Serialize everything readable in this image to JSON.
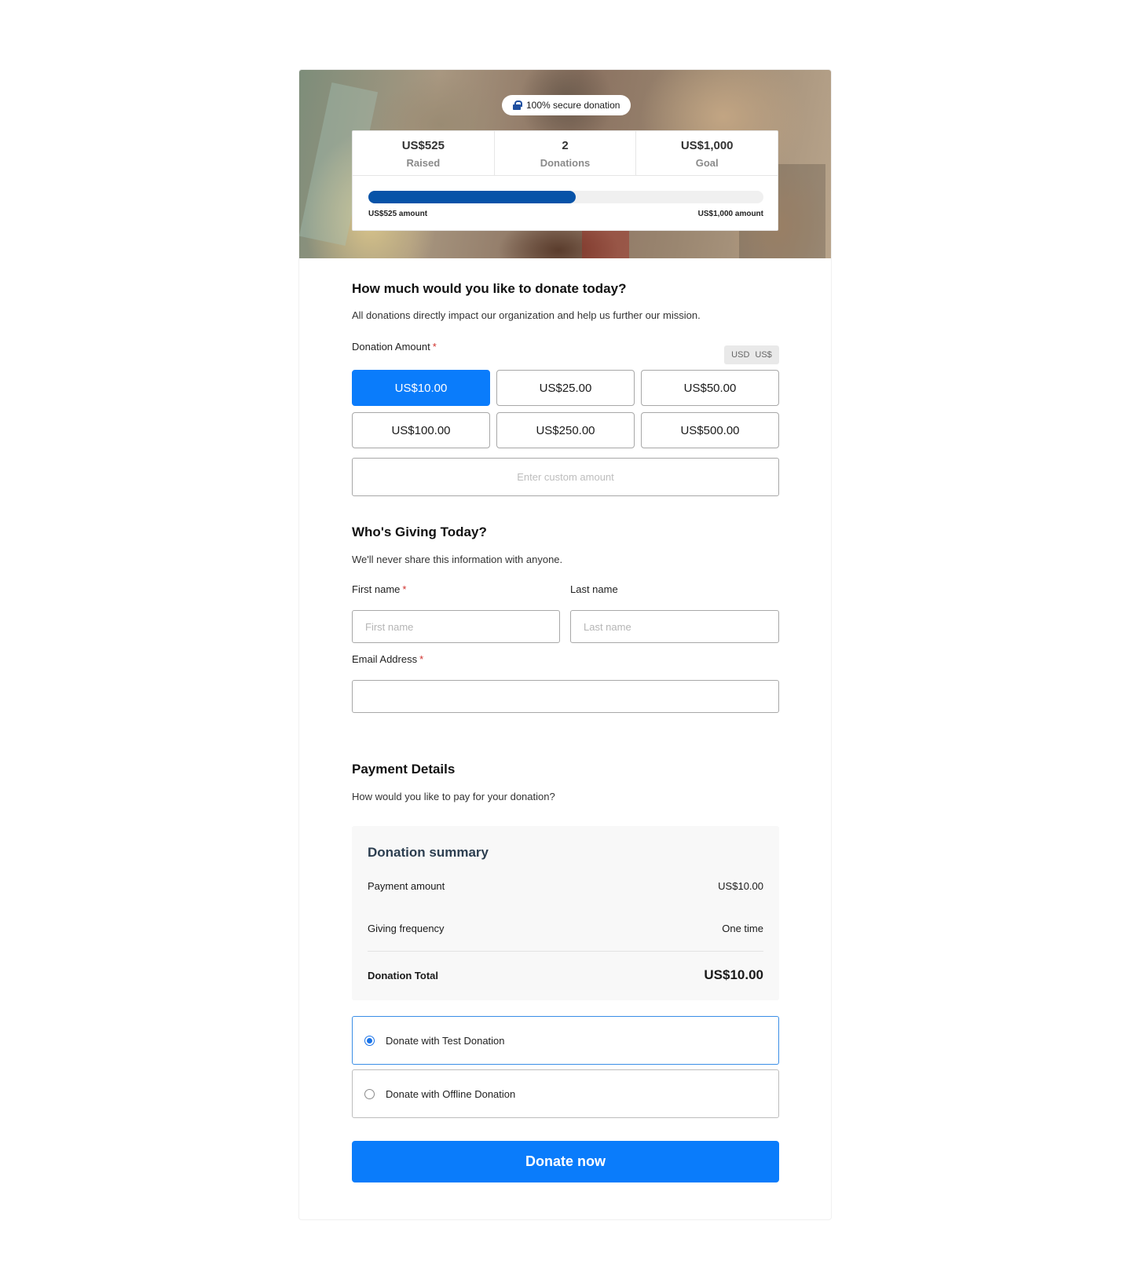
{
  "hero": {
    "secure_badge": "100% secure donation",
    "stats": [
      {
        "value": "US$525",
        "label": "Raised"
      },
      {
        "value": "2",
        "label": "Donations"
      },
      {
        "value": "US$1,000",
        "label": "Goal"
      }
    ],
    "progress_fraction": 0.525,
    "progress_left_label": "US$525 amount",
    "progress_right_label": "US$1,000 amount"
  },
  "amount_section": {
    "title": "How much would you like to donate today?",
    "subtitle": "All donations directly impact our organization and help us further our mission.",
    "field_label": "Donation Amount",
    "required_mark": "*",
    "currency_code": "USD",
    "currency_symbol": "US$",
    "amounts": [
      "US$10.00",
      "US$25.00",
      "US$50.00",
      "US$100.00",
      "US$250.00",
      "US$500.00"
    ],
    "selected_amount": "US$10.00",
    "custom_placeholder": "Enter custom amount"
  },
  "donor_section": {
    "title": "Who's Giving Today?",
    "subtitle": "We'll never share this information with anyone.",
    "first_name_label": "First name",
    "first_name_placeholder": "First name",
    "last_name_label": "Last name",
    "last_name_placeholder": "Last name",
    "email_label": "Email Address",
    "required_mark": "*"
  },
  "payment_section": {
    "title": "Payment Details",
    "subtitle": "How would you like to pay for your donation?",
    "summary": {
      "title": "Donation summary",
      "payment_amount_label": "Payment amount",
      "payment_amount_value": "US$10.00",
      "frequency_label": "Giving frequency",
      "frequency_value": "One time",
      "total_label": "Donation Total",
      "total_value": "US$10.00"
    },
    "options": [
      {
        "label": "Donate with Test Donation",
        "selected": true
      },
      {
        "label": "Donate with Offline Donation",
        "selected": false
      }
    ],
    "donate_button": "Donate now"
  },
  "colors": {
    "primary": "#0a7cfb",
    "progress": "#0753a8",
    "required": "#d0312d"
  }
}
